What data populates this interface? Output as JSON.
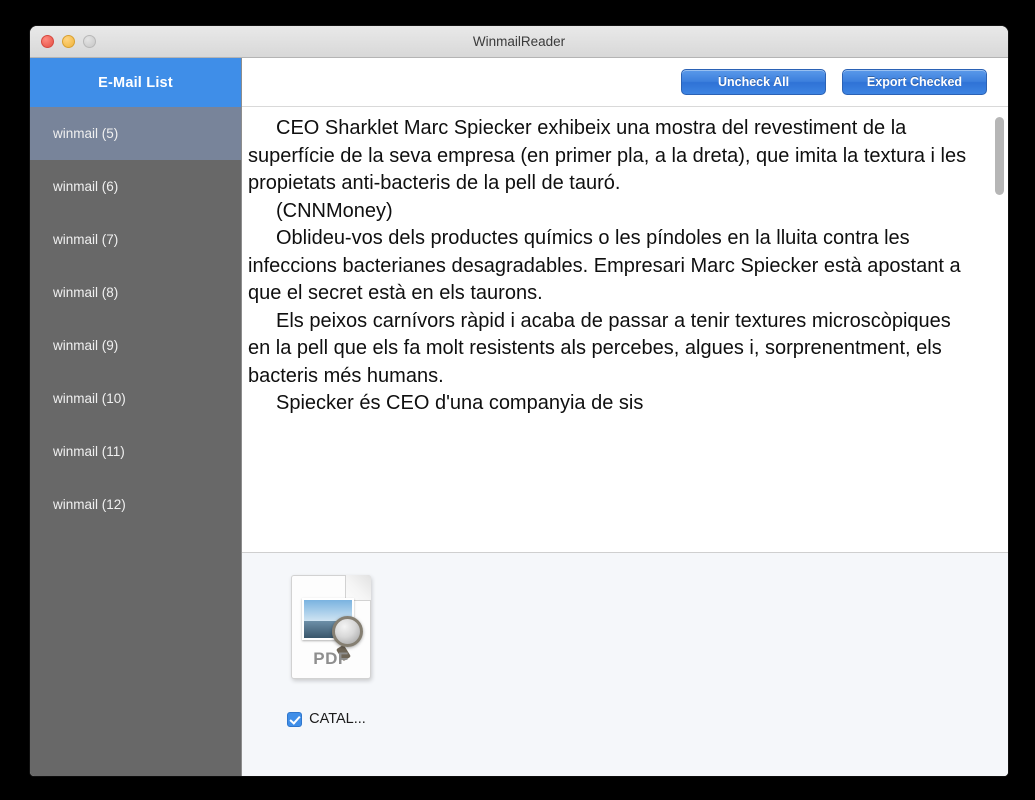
{
  "window": {
    "title": "WinmailReader",
    "traffic_lights": [
      "close-button",
      "minimize-button",
      "zoom-button"
    ]
  },
  "sidebar": {
    "header": "E-Mail List",
    "items": [
      {
        "label": "winmail (5)",
        "selected": true
      },
      {
        "label": "winmail (6)",
        "selected": false
      },
      {
        "label": "winmail (7)",
        "selected": false
      },
      {
        "label": "winmail (8)",
        "selected": false
      },
      {
        "label": "winmail (9)",
        "selected": false
      },
      {
        "label": "winmail (10)",
        "selected": false
      },
      {
        "label": "winmail (11)",
        "selected": false
      },
      {
        "label": "winmail (12)",
        "selected": false
      }
    ]
  },
  "toolbar": {
    "uncheck_all_label": "Uncheck All",
    "export_checked_label": "Export Checked"
  },
  "message": {
    "paragraphs": [
      "CEO Sharklet Marc Spiecker exhibeix una mostra del revestiment de la superfície de la seva empresa (en primer pla, a la dreta), que imita la textura i les propietats anti-bacteris de la pell de tauró.",
      "(CNNMoney)",
      "Oblideu-vos dels productes químics o les píndoles en la lluita contra les infeccions bacterianes desagradables. Empresari Marc Spiecker està apostant a que el secret està en els taurons.",
      "Els peixos carnívors ràpid i acaba de passar a tenir textures microscòpiques en la pell que els fa molt resistents als percebes, algues i, sorprenentment, els bacteris més humans.",
      "Spiecker és CEO d'una companyia de sis"
    ]
  },
  "attachments": {
    "items": [
      {
        "icon": "pdf-document-icon",
        "icon_label": "PDF",
        "name": "CATAL...",
        "checked": true
      }
    ]
  },
  "colors": {
    "accent_blue": "#3f8ee8",
    "sidebar_bg": "#686868",
    "sidebar_selected": "#78849a",
    "attachment_pane_bg": "#f5f7fa"
  }
}
